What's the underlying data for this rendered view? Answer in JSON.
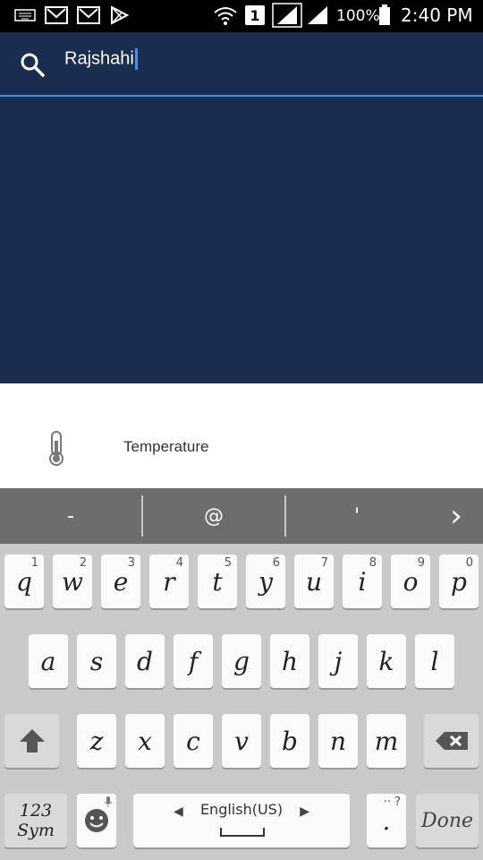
{
  "status_bar": {
    "battery": "100%",
    "time": "2:40 PM",
    "sim_slot": "1",
    "icons": [
      "keyboard-icon",
      "gmail-icon",
      "gmail-icon",
      "play-store-icon",
      "wifi-icon",
      "sim-icon",
      "signal-icon",
      "signal-icon",
      "battery-icon"
    ]
  },
  "search": {
    "value": "Rajshahi",
    "icon": "search-icon"
  },
  "suggestions": [
    {
      "icon": "thermometer-icon",
      "label": "Temperature"
    }
  ],
  "quick_keys": [
    "-",
    "@",
    "'",
    "›"
  ],
  "keyboard": {
    "row1": [
      {
        "key": "q",
        "hint": "1"
      },
      {
        "key": "w",
        "hint": "2"
      },
      {
        "key": "e",
        "hint": "3"
      },
      {
        "key": "r",
        "hint": "4"
      },
      {
        "key": "t",
        "hint": "5"
      },
      {
        "key": "y",
        "hint": "6"
      },
      {
        "key": "u",
        "hint": "7"
      },
      {
        "key": "i",
        "hint": "8"
      },
      {
        "key": "o",
        "hint": "9"
      },
      {
        "key": "p",
        "hint": "0"
      }
    ],
    "row2": [
      "a",
      "s",
      "d",
      "f",
      "g",
      "h",
      "j",
      "k",
      "l"
    ],
    "row3": [
      "z",
      "x",
      "c",
      "v",
      "b",
      "n",
      "m"
    ],
    "sym_label_line1": "123",
    "sym_label_line2": "Sym",
    "language": "English(US)",
    "period": ".",
    "period_hint": "·· ?",
    "done": "Done"
  },
  "colors": {
    "header_bg": "#1b2d4f",
    "accent": "#4a90e2",
    "keyboard_bg": "#c9c9c9",
    "quickbar_bg": "#6d6d6d"
  }
}
